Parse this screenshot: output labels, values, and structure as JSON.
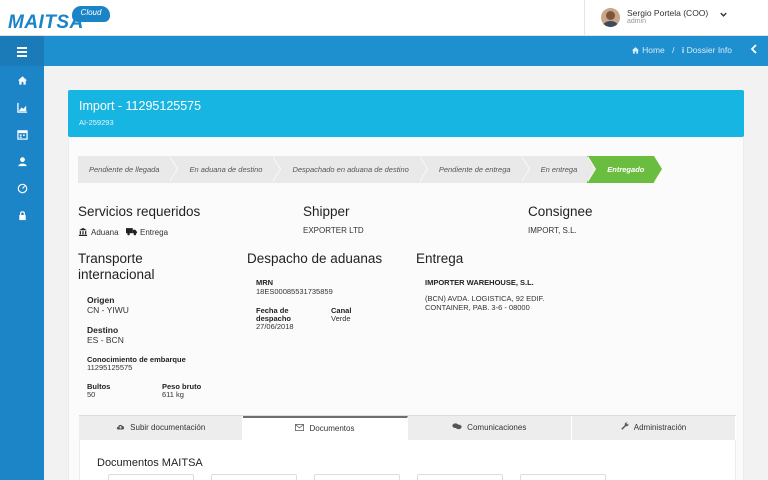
{
  "app": {
    "brand": "MAITSA",
    "brand_badge": "Cloud"
  },
  "user": {
    "name": "Sergio Portela (COO)",
    "role": "admin"
  },
  "breadcrumb": {
    "home": "Home",
    "separator": "/",
    "current": "Dossier Info"
  },
  "sidebar": {
    "items": [
      {
        "icon": "home-icon"
      },
      {
        "icon": "chart-icon"
      },
      {
        "icon": "calendar-icon"
      },
      {
        "icon": "user-icon"
      },
      {
        "icon": "dashboard-icon"
      },
      {
        "icon": "lock-icon"
      }
    ]
  },
  "dossier": {
    "title": "Import - 11295125575",
    "subtitle": "AI-259293"
  },
  "steps": [
    {
      "label": "Pendiente de llegada",
      "active": false
    },
    {
      "label": "En aduana de destino",
      "active": false
    },
    {
      "label": "Despachado en aduana de destino",
      "active": false
    },
    {
      "label": "Pendiente de entrega",
      "active": false
    },
    {
      "label": "En entrega",
      "active": false
    },
    {
      "label": "Entregado",
      "active": true
    }
  ],
  "services": {
    "title": "Servicios requeridos",
    "items": [
      {
        "label": "Aduana",
        "icon": "bank-icon"
      },
      {
        "label": "Entrega",
        "icon": "truck-icon"
      }
    ]
  },
  "shipper": {
    "title": "Shipper",
    "value": "EXPORTER LTD"
  },
  "consignee": {
    "title": "Consignee",
    "value": "IMPORT, S.L."
  },
  "transport": {
    "title_line1": "Transporte",
    "title_line2": "internacional",
    "origin_label": "Origen",
    "origin_value": "CN - YIWU",
    "destination_label": "Destino",
    "destination_value": "ES - BCN",
    "bl_label": "Conocimiento de embarque",
    "bl_value": "11295125575",
    "packages_label": "Bultos",
    "packages_value": "50",
    "gross_label": "Peso bruto",
    "gross_value": "611 kg"
  },
  "customs": {
    "title": "Despacho de aduanas",
    "mrn_label": "MRN",
    "mrn_value": "18ES00085531735859",
    "date_label_line1": "Fecha de",
    "date_label_line2": "despacho",
    "date_value": "27/06/2018",
    "channel_label": "Canal",
    "channel_value": "Verde"
  },
  "delivery": {
    "title": "Entrega",
    "company": "IMPORTER WAREHOUSE, S.L.",
    "address_line1": "(BCN) AVDA. LOGISTICA, 92 EDIF.",
    "address_line2": "CONTAINER, PAB. 3-6 - 08000"
  },
  "tabs": [
    {
      "label": "Subir documentación",
      "icon": "cloud-upload-icon",
      "active": false
    },
    {
      "label": "Documentos",
      "icon": "envelope-icon",
      "active": true
    },
    {
      "label": "Comunicaciones",
      "icon": "comments-icon",
      "active": false
    },
    {
      "label": "Administración",
      "icon": "wrench-icon",
      "active": false
    }
  ],
  "documents": {
    "title": "Documentos MAITSA"
  },
  "colors": {
    "primary": "#1e8fcf",
    "header": "#17b5e1",
    "success": "#6bbd3f",
    "sidebar": "#1c85c8"
  }
}
